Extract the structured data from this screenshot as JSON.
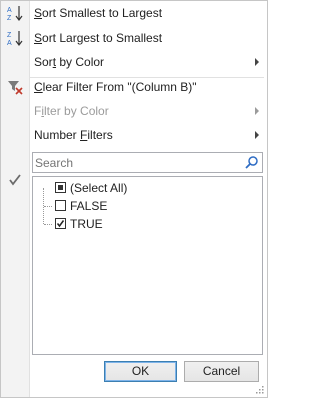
{
  "menu": {
    "sort_asc": {
      "accel": "S",
      "rest": "ort Smallest to Largest"
    },
    "sort_desc": {
      "accel": "S",
      "rest": "ort Largest to Smallest"
    },
    "sort_color": {
      "pre": "Sor",
      "accel": "t",
      "rest": " by Color"
    },
    "clear_filter": {
      "accel": "C",
      "rest": "lear Filter From \"(Column B)\""
    },
    "filter_color": {
      "pre": "F",
      "accel": "i",
      "rest": "lter by Color"
    },
    "number_filters": {
      "pre": "",
      "accel": "F",
      "rest": "ilters",
      "lead": "Number "
    }
  },
  "search": {
    "placeholder": "Search"
  },
  "values": [
    {
      "label": "(Select All)",
      "state": "partial"
    },
    {
      "label": "FALSE",
      "state": "unchecked"
    },
    {
      "label": "TRUE",
      "state": "checked"
    }
  ],
  "buttons": {
    "ok": "OK",
    "cancel": "Cancel"
  },
  "colors": {
    "accent": "#3c7fb1",
    "sort_blue": "#2e6cc4",
    "filter_red": "#c0392b"
  }
}
